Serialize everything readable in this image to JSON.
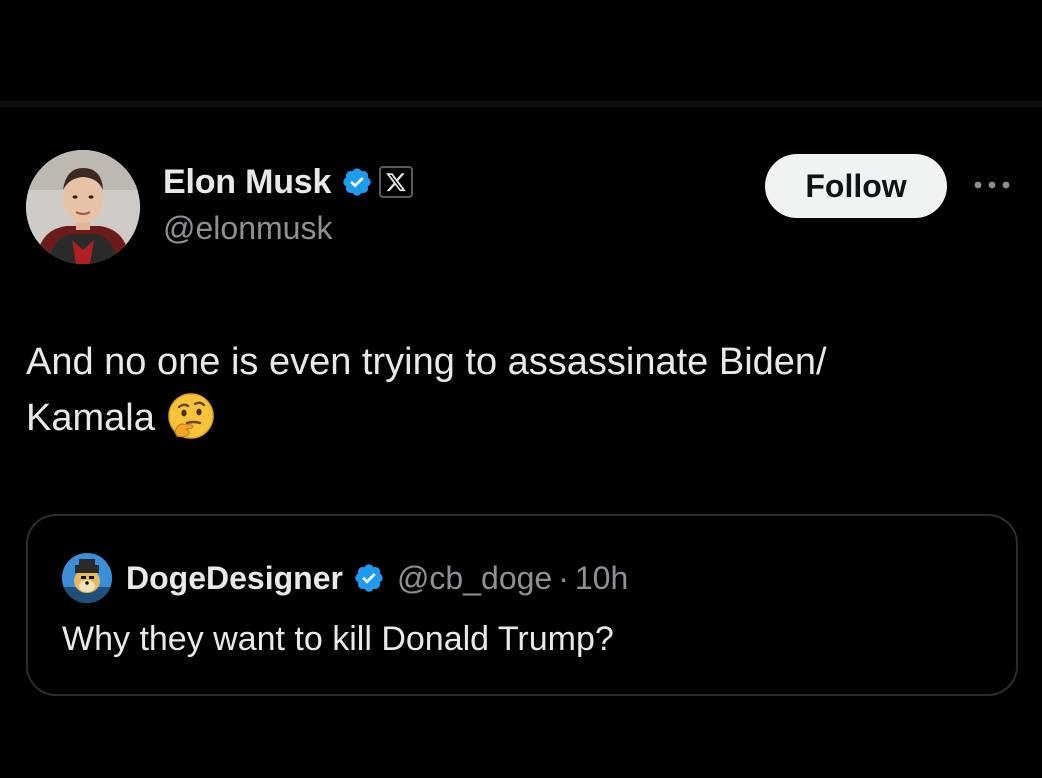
{
  "colors": {
    "background": "#000000",
    "primary_text": "#e7e9ea",
    "secondary_text": "#8b9196",
    "verified_blue": "#1d9bf0",
    "follow_bg": "#eff3f4",
    "border": "#2a2d30"
  },
  "tweet": {
    "author": {
      "display_name": "Elon Musk",
      "handle": "@elonmusk",
      "verified": true,
      "affiliate_badge": "X",
      "avatar_icon": "profile-photo"
    },
    "follow_label": "Follow",
    "more_icon": "more-options-icon",
    "text_line1": "And no one is even trying to assassinate Biden/",
    "text_line2": "Kamala",
    "emoji": "thinking-face",
    "quote": {
      "display_name": "DogeDesigner",
      "handle": "@cb_doge",
      "separator": "·",
      "time": "10h",
      "verified": true,
      "text": "Why they want to kill Donald Trump?"
    }
  }
}
